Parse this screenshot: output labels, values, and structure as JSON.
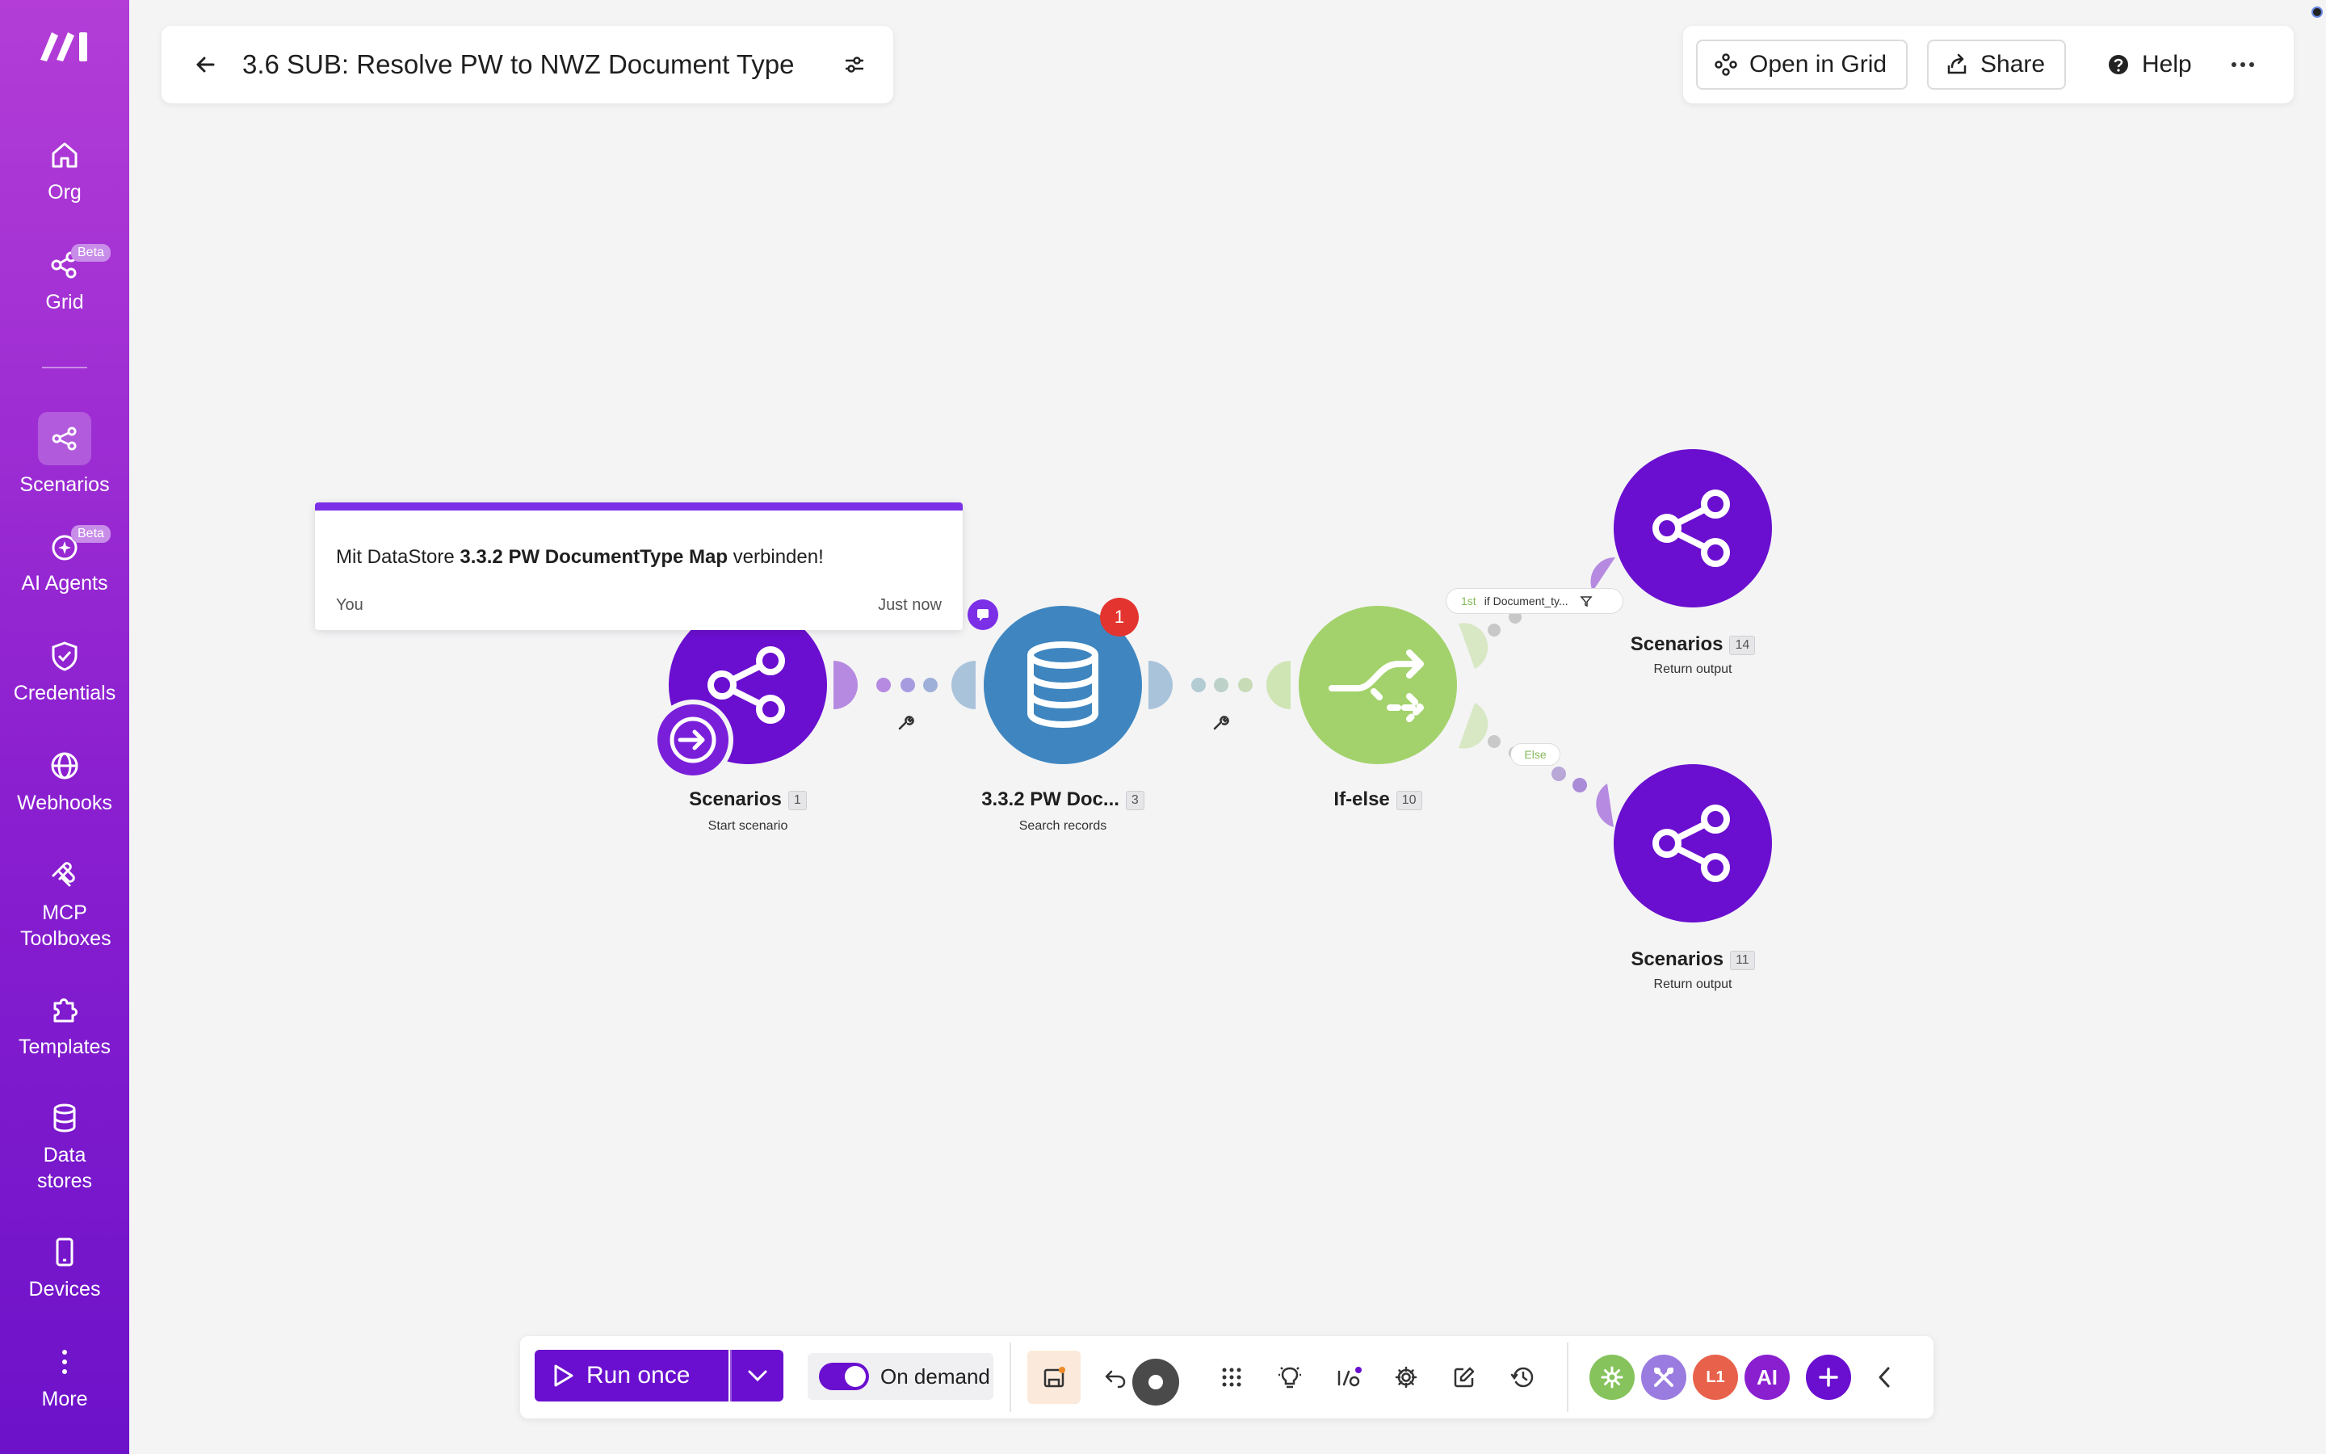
{
  "sidebar": {
    "items": [
      {
        "label": "Org",
        "icon": "home-icon"
      },
      {
        "label": "Grid",
        "icon": "grid-icon",
        "badge": "Beta"
      },
      {
        "label": "Scenarios",
        "icon": "scenarios-icon",
        "active": true
      },
      {
        "label": "AI Agents",
        "icon": "ai-agents-icon",
        "badge": "Beta"
      },
      {
        "label": "Credentials",
        "icon": "shield-icon"
      },
      {
        "label": "Webhooks",
        "icon": "globe-icon"
      },
      {
        "label": "MCP Toolboxes",
        "icon": "mcp-icon"
      },
      {
        "label": "Templates",
        "icon": "puzzle-icon"
      },
      {
        "label": "Data stores",
        "icon": "database-icon"
      },
      {
        "label": "Devices",
        "icon": "phone-icon"
      },
      {
        "label": "More",
        "icon": "more-vertical-icon"
      }
    ]
  },
  "header": {
    "title": "3.6 SUB: Resolve PW to NWZ Document Type",
    "actions": {
      "open_in_grid": "Open in Grid",
      "share": "Share",
      "help": "Help"
    }
  },
  "note": {
    "prefix": "Mit DataStore ",
    "bold": "3.3.2 PW DocumentType Map",
    "suffix": " verbinden!",
    "author": "You",
    "time": "Just now"
  },
  "modules": [
    {
      "name": "Scenarios",
      "num": "1",
      "sub": "Start scenario",
      "color": "#6a0fcf"
    },
    {
      "name": "3.3.2 PW Doc...",
      "num": "3",
      "sub": "Search records",
      "color": "#3f86c0",
      "badge": "1"
    },
    {
      "name": "If-else",
      "num": "10",
      "sub": "",
      "color": "#a3d26c"
    },
    {
      "name": "Scenarios",
      "num": "14",
      "sub": "Return output",
      "color": "#6a0fcf"
    },
    {
      "name": "Scenarios",
      "num": "11",
      "sub": "Return output",
      "color": "#6a0fcf"
    }
  ],
  "routes": {
    "first": {
      "tag": "1st",
      "condition": "if Document_ty..."
    },
    "else": {
      "tag": "Else"
    }
  },
  "toolbar": {
    "run_once": "Run once",
    "schedule": "On demand",
    "avatars": [
      {
        "label": "",
        "color": "#86c35c"
      },
      {
        "label": "",
        "color": "#9a7be0"
      },
      {
        "label": "L1",
        "color": "#e8614a"
      },
      {
        "label": "AI",
        "color": "#8a1fd0"
      }
    ]
  }
}
